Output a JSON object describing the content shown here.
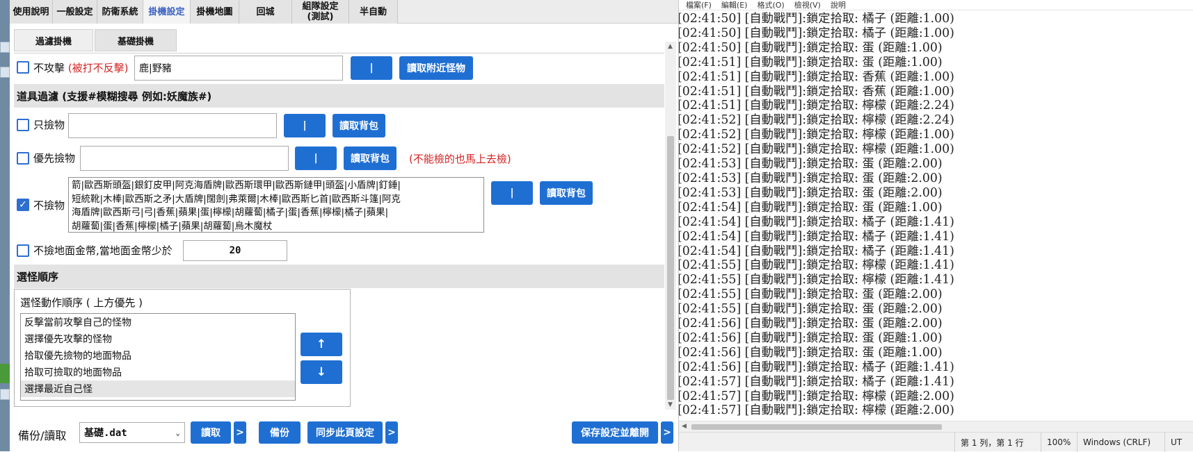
{
  "tabs": [
    "使用說明",
    "一般設定",
    "防衛系統",
    "掛機設定",
    "掛機地圖",
    "回城",
    "組隊設定\n(測試)",
    "半自動"
  ],
  "active_tab": "掛機設定",
  "subtabs": [
    "過濾掛機",
    "基礎掛機"
  ],
  "no_attack": {
    "label": "不攻擊",
    "note": "(被打不反擊)",
    "value": "鹿|野豬",
    "sep_label": "|",
    "read_label": "讀取附近怪物",
    "checked": false
  },
  "item_filter": {
    "title": "道具過濾 (支援#模糊搜尋 例如:妖魔族#)",
    "only_pick": {
      "label": "只撿物",
      "value": "",
      "sep_label": "|",
      "read_label": "讀取背包",
      "checked": false
    },
    "priority_pick": {
      "label": "優先撿物",
      "value": "",
      "sep_label": "|",
      "read_label": "讀取背包",
      "note": "(不能檢的也馬上去檢)",
      "checked": false
    },
    "no_pick": {
      "label": "不撿物",
      "checked": true,
      "lines": [
        "箭|歐西斯頭盔|銀釘皮甲|阿克海盾牌|歐西斯環甲|歐西斯鏈甲|頭盔|小盾牌|釘錘|",
        "短統靴|木棒|歐西斯之矛|大盾牌|闊劍|弗萊爾|木棒|歐西斯匕首|歐西斯斗篷|阿克",
        "海盾牌|歐西斯弓|弓|香蕉|蘋果|蛋|檸檬|胡蘿蔔|橘子|蛋|香蕉|檸檬|橘子|蘋果|",
        "胡蘿蔔|蛋|香蕉|檸檬|橘子|蘋果|胡蘿蔔|烏木魔杖"
      ],
      "sep_label": "|",
      "read_label": "讀取背包"
    },
    "gold": {
      "label": "不撿地面金幣,當地面金幣少於",
      "value": "20",
      "checked": false
    }
  },
  "monster_order": {
    "title": "選怪順序",
    "group_title": "選怪動作順序 ( 上方優先 )",
    "items": [
      "反擊當前攻擊自己的怪物",
      "選擇優先攻擊的怪物",
      "拾取優先撿物的地面物品",
      "拾取可撿取的地面物品",
      "選擇最近自己怪"
    ],
    "selected_index": 4,
    "up_label": "↑",
    "down_label": "↓"
  },
  "footer": {
    "label": "備份/讀取",
    "file": "基礎.dat",
    "read_label": "讀取",
    "backup_label": "備份",
    "sync_label": "同步此頁設定",
    "save_label": "保存設定並離開",
    "more_label": ">"
  },
  "notepad": {
    "menu": [
      "檔案(F)",
      "編輯(E)",
      "格式(O)",
      "檢視(V)",
      "說明"
    ],
    "lines": [
      "[02:41:50] [自動戰鬥]:鎖定拾取: 橘子 (距離:1.00)",
      "[02:41:50] [自動戰鬥]:鎖定拾取: 橘子 (距離:1.00)",
      "[02:41:50] [自動戰鬥]:鎖定拾取: 蛋 (距離:1.00)",
      "[02:41:51] [自動戰鬥]:鎖定拾取: 蛋 (距離:1.00)",
      "[02:41:51] [自動戰鬥]:鎖定拾取: 香蕉 (距離:1.00)",
      "[02:41:51] [自動戰鬥]:鎖定拾取: 香蕉 (距離:1.00)",
      "[02:41:51] [自動戰鬥]:鎖定拾取: 檸檬 (距離:2.24)",
      "[02:41:52] [自動戰鬥]:鎖定拾取: 檸檬 (距離:2.24)",
      "[02:41:52] [自動戰鬥]:鎖定拾取: 檸檬 (距離:1.00)",
      "[02:41:52] [自動戰鬥]:鎖定拾取: 檸檬 (距離:1.00)",
      "[02:41:53] [自動戰鬥]:鎖定拾取: 蛋 (距離:2.00)",
      "[02:41:53] [自動戰鬥]:鎖定拾取: 蛋 (距離:2.00)",
      "[02:41:53] [自動戰鬥]:鎖定拾取: 蛋 (距離:2.00)",
      "[02:41:54] [自動戰鬥]:鎖定拾取: 蛋 (距離:1.00)",
      "[02:41:54] [自動戰鬥]:鎖定拾取: 橘子 (距離:1.41)",
      "[02:41:54] [自動戰鬥]:鎖定拾取: 橘子 (距離:1.41)",
      "[02:41:54] [自動戰鬥]:鎖定拾取: 橘子 (距離:1.41)",
      "[02:41:55] [自動戰鬥]:鎖定拾取: 檸檬 (距離:1.41)",
      "[02:41:55] [自動戰鬥]:鎖定拾取: 檸檬 (距離:1.41)",
      "[02:41:55] [自動戰鬥]:鎖定拾取: 蛋 (距離:2.00)",
      "[02:41:55] [自動戰鬥]:鎖定拾取: 蛋 (距離:2.00)",
      "[02:41:56] [自動戰鬥]:鎖定拾取: 蛋 (距離:2.00)",
      "[02:41:56] [自動戰鬥]:鎖定拾取: 蛋 (距離:1.00)",
      "[02:41:56] [自動戰鬥]:鎖定拾取: 蛋 (距離:1.00)",
      "[02:41:56] [自動戰鬥]:鎖定拾取: 橘子 (距離:1.41)",
      "[02:41:57] [自動戰鬥]:鎖定拾取: 橘子 (距離:1.41)",
      "[02:41:57] [自動戰鬥]:鎖定拾取: 檸檬 (距離:2.00)",
      "[02:41:57] [自動戰鬥]:鎖定拾取: 檸檬 (距離:2.00)"
    ],
    "status": {
      "position": "第 1 列，第 1 行",
      "zoom": "100%",
      "eol": "Windows (CRLF)",
      "encoding": "UT"
    }
  },
  "colors": {
    "accent": "#1f6fd3",
    "warning": "#d32222",
    "section": "#e3e3e3"
  },
  "icons": [
    "checkbox-icon",
    "checkmark-icon",
    "dropdown-chevron-icon",
    "arrow-up-icon",
    "arrow-down-icon"
  ]
}
